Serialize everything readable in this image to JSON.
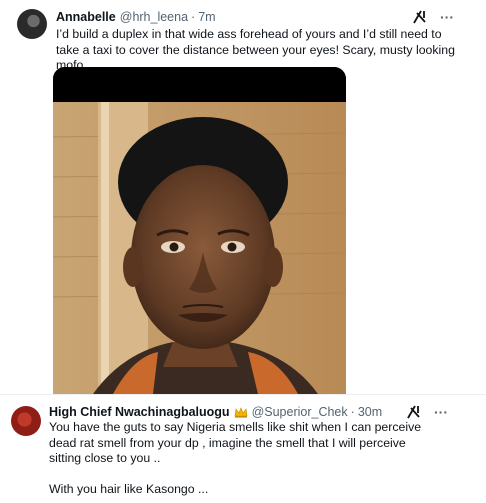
{
  "tweets": [
    {
      "name": "Annabelle",
      "handle": "@hrh_leena",
      "separator": "·",
      "time": "7m",
      "more": "···",
      "text": "I’d build a duplex in that wide ass forehead of yours and I’d still need to take a taxi to cover the distance between your eyes! Scary, musty looking mofo.",
      "icons": [
        "avatar",
        "grok-icon",
        "more-icon"
      ],
      "media": "selfie-photo"
    },
    {
      "name": "High Chief Nwachinagbaluogu",
      "handle": "@Superior_Chek",
      "separator": "·",
      "time": "30m",
      "more": "···",
      "text": "You have the guts to say Nigeria smells like shit when I can perceive dead rat smell from your dp , imagine the smell that I will perceive sitting close to you ..",
      "text2": "With you hair like Kasongo ...",
      "icons": [
        "avatar",
        "crown-icon",
        "grok-icon",
        "more-icon"
      ]
    }
  ],
  "colors": {
    "text": "#0f1419",
    "secondary": "#536471",
    "background": "#ffffff"
  }
}
